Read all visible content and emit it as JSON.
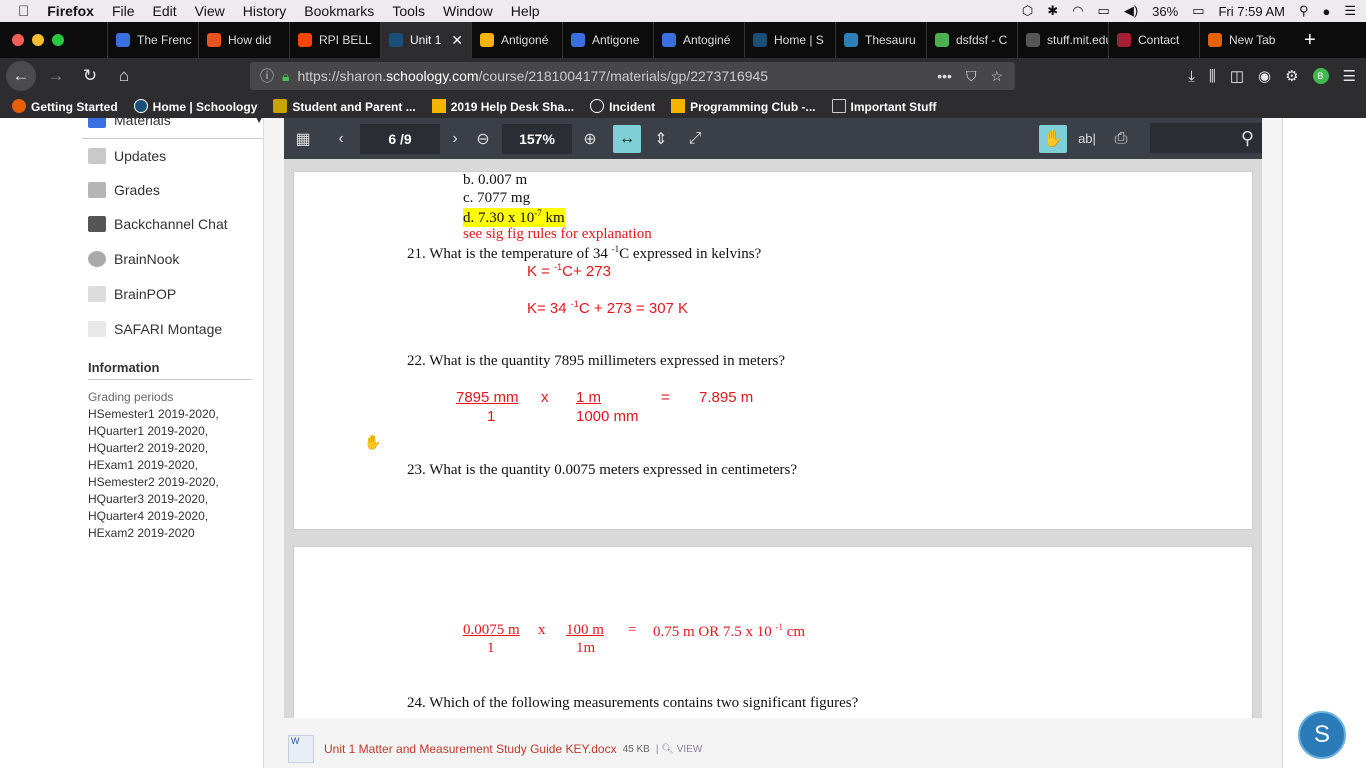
{
  "menubar": {
    "apple": "",
    "app": "Firefox",
    "items": [
      "File",
      "Edit",
      "View",
      "History",
      "Bookmarks",
      "Tools",
      "Window",
      "Help"
    ],
    "battery": "36%",
    "clock": "Fri 7:59 AM"
  },
  "tabs": [
    {
      "label": "The Frenc",
      "color": "#3b6fe0"
    },
    {
      "label": "How did",
      "color": "#e8541e"
    },
    {
      "label": "RPI BELL",
      "color": "#ff4500"
    },
    {
      "label": "Unit 1",
      "color": "#1a4f7a"
    },
    {
      "label": "Antigoné",
      "color": "#f4b400"
    },
    {
      "label": "Antigone",
      "color": "#3b6fe0"
    },
    {
      "label": "Antoginé",
      "color": "#3b6fe0"
    },
    {
      "label": "Home | S",
      "color": "#1a4f7a"
    },
    {
      "label": "Thesauru",
      "color": "#2f7fb8"
    },
    {
      "label": "dsfdsf - C",
      "color": "#4caf50"
    },
    {
      "label": "stuff.mit.edu/",
      "color": "#555555"
    },
    {
      "label": "Contact",
      "color": "#a31f34"
    },
    {
      "label": "New Tab",
      "color": "#e66000"
    }
  ],
  "tab_close": "✕",
  "new_tab": "+",
  "url": {
    "prefix": "https://sharon.",
    "host": "schoology.com",
    "path": "/course/2181004177/materials/gp/2273716945"
  },
  "bookmarks": [
    "Getting Started",
    "Home | Schoology",
    "Student and Parent ...",
    "2019 Help Desk Sha...",
    "Incident",
    "Programming Club -...",
    "Important Stuff"
  ],
  "sidebar": {
    "materials": "Materials",
    "items": [
      "Updates",
      "Grades",
      "Backchannel Chat",
      "BrainNook",
      "BrainPOP",
      "SAFARI Montage"
    ],
    "information": "Information",
    "grading_label": "Grading periods",
    "periods": [
      "HSemester1 2019-2020,",
      "HQuarter1 2019-2020,",
      "HQuarter2 2019-2020,",
      "HExam1 2019-2020,",
      "HSemester2 2019-2020,",
      "HQuarter3 2019-2020,",
      "HQuarter4 2019-2020,",
      "HExam2 2019-2020"
    ]
  },
  "viewer": {
    "page_current": "6",
    "page_total": "/9",
    "zoom": "157%"
  },
  "doc": {
    "ansb": "b.    0.007 m",
    "ansc": "c.    7077 mg",
    "ansd_pre": "d.    7.30 x 10",
    "ansd_sup": "-7",
    "ansd_post": " km",
    "sigfig": "see sig fig rules for explanation",
    "q21": "21.  What is the temperature of 34 ",
    "q21_sup": "-1",
    "q21_post": "C expressed in kelvins?",
    "k1": "K = ",
    "k1_sup": "-1",
    "k1_post": "C+ 273",
    "k2": "K= 34 ",
    "k2_sup": "-1",
    "k2_post": "C + 273 = 307 K",
    "q22": "22.  What is the quantity 7895 millimeters expressed in meters?",
    "c22_num": "7895 mm",
    "c22_x": "x",
    "c22_num2": "1 m",
    "c22_eq": "=",
    "c22_res": "7.895 m",
    "c22_den": "1",
    "c22_den2": "1000 mm",
    "q23": "23.  What is the quantity 0.0075 meters expressed in centimeters?",
    "c23_num": "0.0075 m",
    "c23_x": "x",
    "c23_num2": "100  m",
    "c23_eq": "=",
    "c23_res": "0.75 m  OR 7.5 x 10 ",
    "c23_sup": "-1",
    "c23_unit": " cm",
    "c23_den": "1",
    "c23_den2": "1m",
    "q24": "24.  Which of the following measurements contains two significant figures?"
  },
  "attachment": {
    "name": "Unit 1 Matter and Measurement Study Guide KEY.docx",
    "size": "45 KB",
    "view": "VIEW"
  },
  "chat_letter": "S"
}
